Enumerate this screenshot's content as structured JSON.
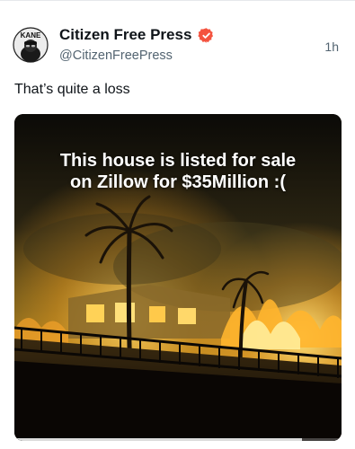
{
  "post": {
    "author_name": "Citizen Free Press",
    "author_handle": "@CitizenFreePress",
    "timestamp": "1h",
    "verified": true,
    "verified_badge_color": "#f4533f",
    "avatar_text": "KANE",
    "text": "That’s quite a loss",
    "media": {
      "type": "video",
      "caption_lines": [
        "This house is listed for sale",
        "on Zillow for $35Million :("
      ],
      "progress_fraction": 0.88
    }
  },
  "colors": {
    "text_primary": "#0f1419",
    "text_secondary": "#536471",
    "divider": "#e6e8eb"
  }
}
